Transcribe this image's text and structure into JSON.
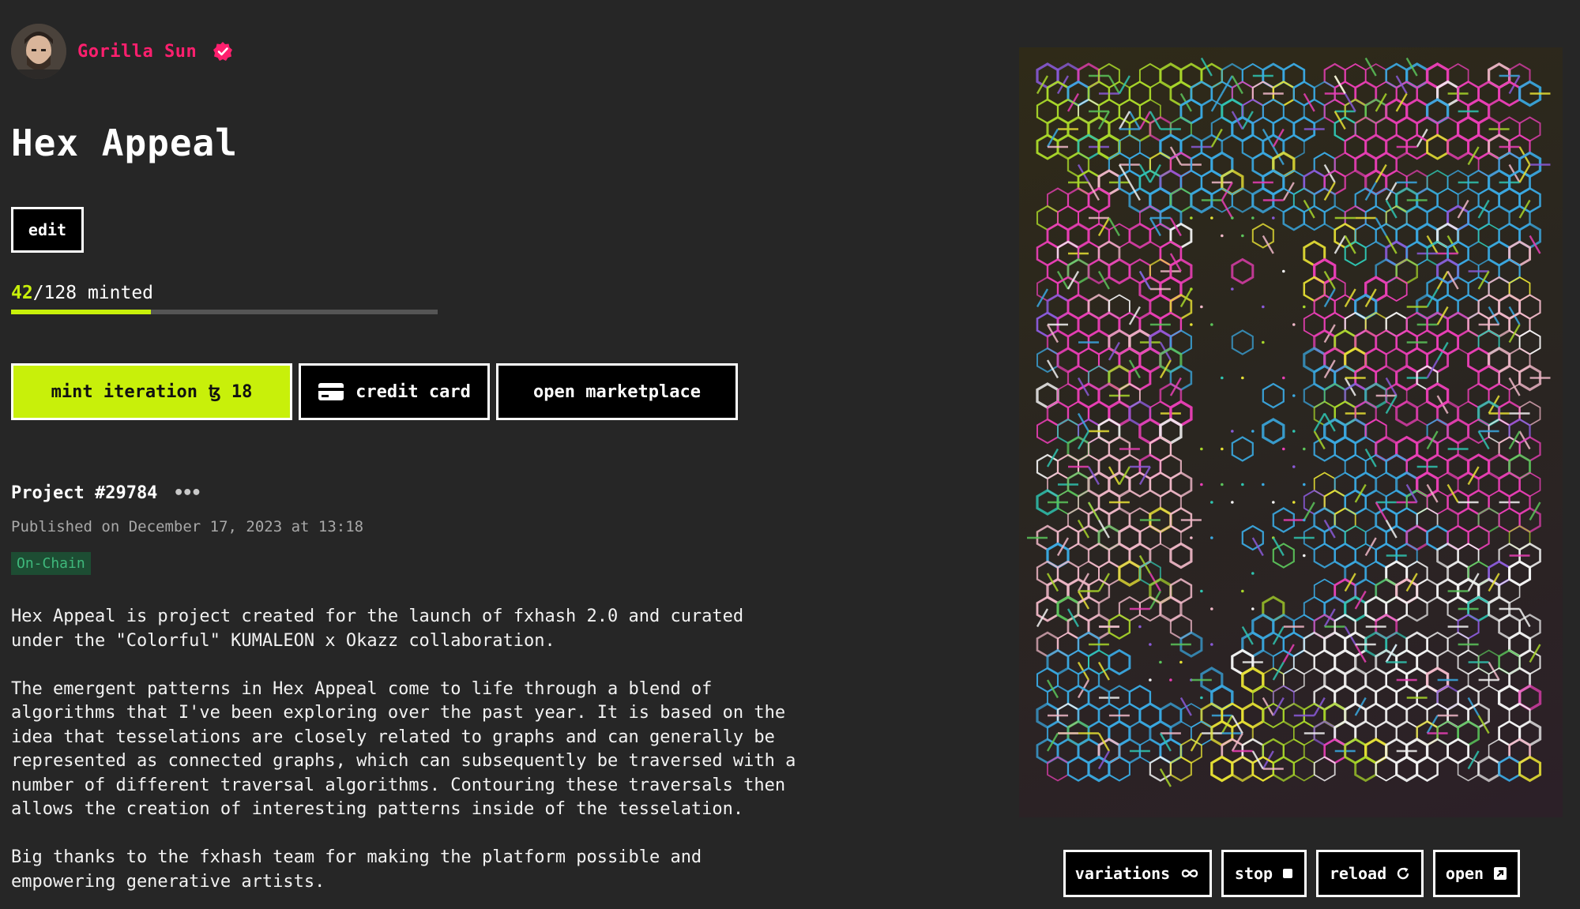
{
  "author": {
    "name": "Gorilla Sun",
    "verified": true,
    "avatar_icon": "avatar-photo"
  },
  "project": {
    "title": "Hex Appeal",
    "edit_label": "edit",
    "minted": {
      "count": "42",
      "total": "/128",
      "suffix": " minted",
      "progress": 0.328
    },
    "actions": {
      "mint_label": "mint iteration",
      "mint_price": "ꜩ 18",
      "credit_card_label": "credit card",
      "marketplace_label": "open marketplace"
    },
    "id_label": "Project #29784",
    "more_icon": "•••",
    "published": "Published on December 17, 2023 at 13:18",
    "badge": "On-Chain",
    "description": [
      "Hex Appeal is project created for the launch of fxhash 2.0 and curated\nunder the \"Colorful\" KUMALEON x Okazz collaboration.",
      "The emergent patterns in Hex Appeal come to life through a blend of\nalgorithms that I've been exploring over the past year. It is based on the\nidea that tesselations are closely related to graphs and can generally be\nrepresented as connected graphs, which can subsequently be traversed with a\nnumber of different traversal algorithms. Contouring these traversals then\nallows the creation of interesting patterns inside of the tesselation.",
      "Big thanks to the fxhash team for making the platform possible and\nempowering generative artists."
    ]
  },
  "controls": {
    "variations_label": "variations",
    "stop_label": "stop",
    "reload_label": "reload",
    "open_label": "open"
  },
  "colors": {
    "accent_lime": "#c8f00a",
    "author_pink": "#ff1f6e",
    "background": "#262626",
    "badge_bg": "#1d4d33",
    "badge_text": "#3fb97c",
    "art_palette": [
      "#a8d62a",
      "#e93fb5",
      "#3aa8e0",
      "#f2f2f2",
      "#e6e034",
      "#5bc45a",
      "#2fc4b0",
      "#8a5ad8",
      "#f0b8c8"
    ]
  }
}
